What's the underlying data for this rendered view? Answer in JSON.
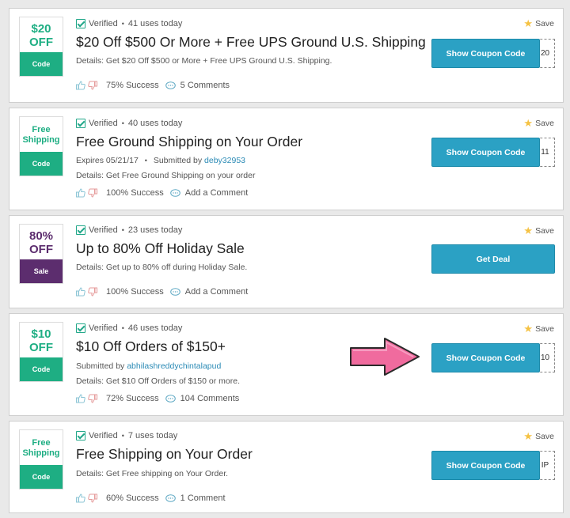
{
  "colors": {
    "green": "#1eae83",
    "purple": "#5c2d6e",
    "button": "#2ba1c4"
  },
  "icons": [
    "check-icon",
    "thumbs-up-icon",
    "thumbs-down-icon",
    "comment-icon",
    "star-icon",
    "arrow-icon"
  ],
  "coupons": [
    {
      "badge_top": "$20\nOFF",
      "badge_type": "Code",
      "verified": "Verified",
      "uses": "41 uses today",
      "title": "$20 Off $500 Or More + Free UPS Ground U.S. Shipping",
      "details": "Details:  Get $20 Off $500 or More + Free UPS Ground U.S. Shipping.",
      "success": "75% Success",
      "comments": "5 Comments",
      "save": "Save",
      "button": "Show Coupon Code",
      "code_peek": "20"
    },
    {
      "badge_top": "Free\nShipping",
      "badge_type": "Code",
      "verified": "Verified",
      "uses": "40 uses today",
      "title": "Free Ground Shipping on Your Order",
      "expires": "Expires 05/21/17",
      "submitted_label": "Submitted by",
      "submitted_user": "deby32953",
      "details": "Details:  Get Free Ground Shipping on your order",
      "success": "100% Success",
      "comments": "Add a Comment",
      "save": "Save",
      "button": "Show Coupon Code",
      "code_peek": "11"
    },
    {
      "badge_top": "80%\nOFF",
      "badge_type": "Sale",
      "verified": "Verified",
      "uses": "23 uses today",
      "title": "Up to 80% Off Holiday Sale",
      "details": "Details:  Get up to 80% off during Holiday Sale.",
      "success": "100% Success",
      "comments": "Add a Comment",
      "save": "Save",
      "button": "Get Deal"
    },
    {
      "badge_top": "$10\nOFF",
      "badge_type": "Code",
      "verified": "Verified",
      "uses": "46 uses today",
      "title": "$10 Off Orders of $150+",
      "submitted_label": "Submitted by",
      "submitted_user": "abhilashreddychintalapud",
      "details": "Details:  Get $10 Off Orders of $150 or more.",
      "success": "72% Success",
      "comments": "104 Comments",
      "save": "Save",
      "button": "Show Coupon Code",
      "code_peek": "10"
    },
    {
      "badge_top": "Free\nShipping",
      "badge_type": "Code",
      "verified": "Verified",
      "uses": "7 uses today",
      "title": "Free Shipping on Your Order",
      "details": "Details:  Get Free shipping on Your Order.",
      "success": "60% Success",
      "comments": "1 Comment",
      "save": "Save",
      "button": "Show Coupon Code",
      "code_peek": "IP"
    }
  ]
}
